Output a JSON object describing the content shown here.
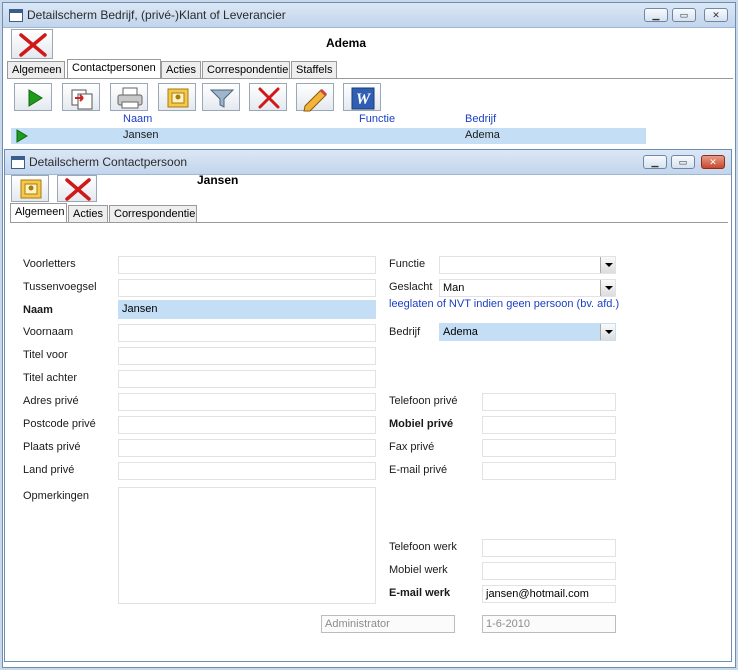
{
  "outer": {
    "title": "Detailscherm Bedrijf, (privé-)Klant of Leverancier",
    "company_name": "Adema",
    "tabs": [
      "Algemeen",
      "Contactpersonen",
      "Acties",
      "Correspondentie",
      "Staffels"
    ],
    "active_tab": "Contactpersonen",
    "toolbar_icons": [
      "play-icon",
      "copy-icon",
      "print-icon",
      "card-icon",
      "filter-icon",
      "delete-icon",
      "edit-icon",
      "word-icon"
    ],
    "list": {
      "headers": {
        "naam": "Naam",
        "functie": "Functie",
        "bedrijf": "Bedrijf"
      },
      "row": {
        "naam": "Jansen",
        "functie": "",
        "bedrijf": "Adema"
      }
    }
  },
  "inner": {
    "title": "Detailscherm Contactpersoon",
    "person_name": "Jansen",
    "tabs": [
      "Algemeen",
      "Acties",
      "Correspondentie"
    ],
    "active_tab": "Algemeen",
    "form": {
      "voorletters": {
        "label": "Voorletters",
        "value": ""
      },
      "tussenvoegsel": {
        "label": "Tussenvoegsel",
        "value": ""
      },
      "naam": {
        "label": "Naam",
        "value": "Jansen"
      },
      "voornaam": {
        "label": "Voornaam",
        "value": ""
      },
      "titel_voor": {
        "label": "Titel voor",
        "value": ""
      },
      "titel_achter": {
        "label": "Titel achter",
        "value": ""
      },
      "adres_prive": {
        "label": "Adres privé",
        "value": ""
      },
      "postcode_prive": {
        "label": "Postcode privé",
        "value": ""
      },
      "plaats_prive": {
        "label": "Plaats privé",
        "value": ""
      },
      "land_prive": {
        "label": "Land privé",
        "value": ""
      },
      "opmerkingen": {
        "label": "Opmerkingen",
        "value": ""
      },
      "functie": {
        "label": "Functie",
        "value": ""
      },
      "geslacht": {
        "label": "Geslacht",
        "value": "Man"
      },
      "hint": "leeglaten of NVT indien geen persoon (bv. afd.)",
      "bedrijf": {
        "label": "Bedrijf",
        "value": "Adema"
      },
      "telefoon_prive": {
        "label": "Telefoon privé",
        "value": ""
      },
      "mobiel_prive": {
        "label": "Mobiel privé",
        "value": ""
      },
      "fax_prive": {
        "label": "Fax privé",
        "value": ""
      },
      "email_prive": {
        "label": "E-mail privé",
        "value": ""
      },
      "telefoon_werk": {
        "label": "Telefoon werk",
        "value": ""
      },
      "mobiel_werk": {
        "label": "Mobiel werk",
        "value": ""
      },
      "email_werk": {
        "label": "E-mail werk",
        "value": "jansen@hotmail.com"
      },
      "modified_by": "Administrator",
      "modified_date": "1-6-2010"
    }
  },
  "colors": {
    "selection": "#c3def5",
    "hint_text": "#1a3fc4",
    "title_bar": "#c2d5ec"
  }
}
